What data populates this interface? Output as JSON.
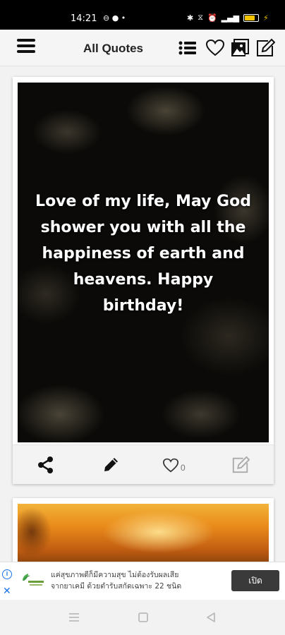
{
  "status_bar": {
    "time": "14:21",
    "app_indicators": "⊖ ● •",
    "system_icons": [
      "bluetooth-icon",
      "wifi-icon",
      "alarm-icon",
      "signal-icon"
    ],
    "battery_level": 0.75,
    "battery_color": "#f4c400"
  },
  "app_bar": {
    "title": "All Quotes",
    "icons": [
      "menu-icon",
      "list-icon",
      "heart-icon",
      "gallery-icon",
      "edit-icon"
    ]
  },
  "quotes": [
    {
      "text": "Love of my life, May God shower you with all the happiness of earth and heavens. Happy birthday!",
      "background": "dark-chocolate-image",
      "like_count": "0",
      "actions": [
        "share-icon",
        "pencil-icon",
        "like-icon",
        "edit-square-icon"
      ]
    },
    {
      "background": "sunset-orange-image"
    }
  ],
  "ad": {
    "text_line1": "แค่สุขภาพดีก็มีความสุข ไม่ต้องรับผลเสีย",
    "text_line2": "จากยาเคมี ด้วยตำรับสกัดเฉพาะ 22 ชนิด",
    "cta": "เปิด",
    "accent": "#1a73e8"
  },
  "nav_bar": {
    "icons": [
      "recents-icon",
      "home-icon",
      "back-icon"
    ]
  }
}
